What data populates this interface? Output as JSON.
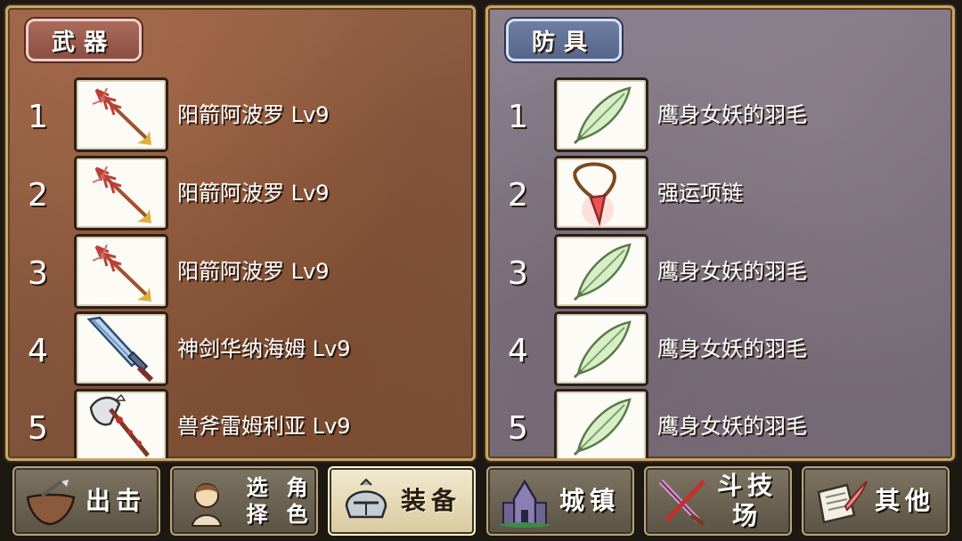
{
  "weapons": {
    "title": "武器",
    "slots": [
      {
        "num": "1",
        "name": "阳箭阿波罗 Lv9",
        "icon": "arrow-icon"
      },
      {
        "num": "2",
        "name": "阳箭阿波罗 Lv9",
        "icon": "arrow-icon"
      },
      {
        "num": "3",
        "name": "阳箭阿波罗 Lv9",
        "icon": "arrow-icon"
      },
      {
        "num": "4",
        "name": "神剑华纳海姆 Lv9",
        "icon": "sword-icon"
      },
      {
        "num": "5",
        "name": "兽斧雷姆利亚 Lv9",
        "icon": "axe-icon"
      }
    ]
  },
  "armor": {
    "title": "防具",
    "slots": [
      {
        "num": "1",
        "name": "鹰身女妖的羽毛",
        "icon": "feather-icon"
      },
      {
        "num": "2",
        "name": "强运项链",
        "icon": "necklace-icon"
      },
      {
        "num": "3",
        "name": "鹰身女妖的羽毛",
        "icon": "feather-icon"
      },
      {
        "num": "4",
        "name": "鹰身女妖的羽毛",
        "icon": "feather-icon"
      },
      {
        "num": "5",
        "name": "鹰身女妖的羽毛",
        "icon": "feather-icon"
      }
    ]
  },
  "nav": {
    "sortie": "出击",
    "select_line1": "选择",
    "select_line2": "角色",
    "equip": "装备",
    "town": "城镇",
    "arena": "斗技场",
    "other": "其他",
    "active": "equip"
  },
  "colors": {
    "weapons_panel": "#85553c",
    "armor_panel": "#7b707c",
    "weapons_badge": "#a96b5b",
    "armor_badge": "#6f7fa3",
    "nav_active": "#f2ead0"
  }
}
